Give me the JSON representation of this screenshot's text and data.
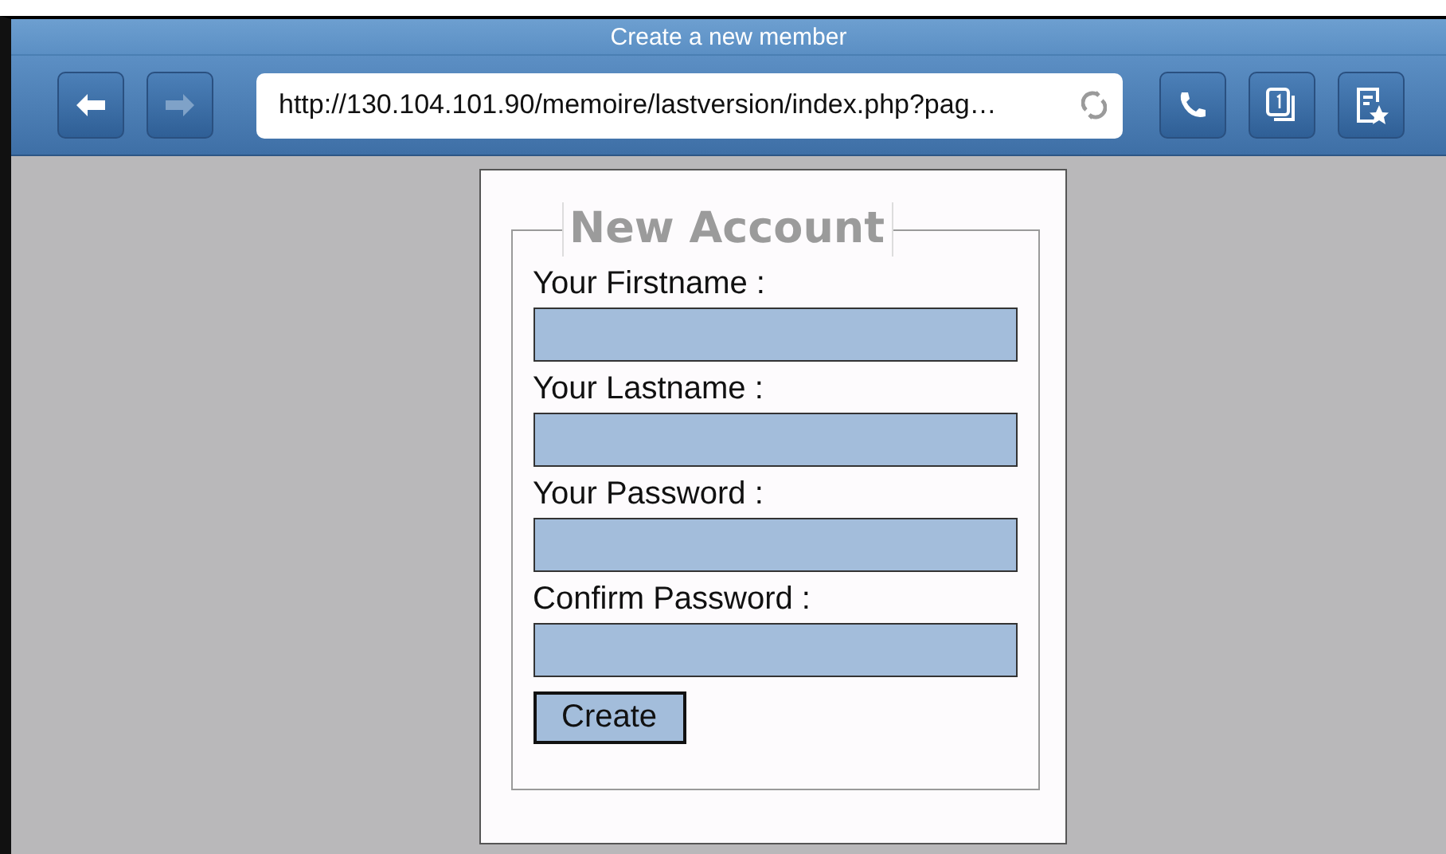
{
  "window": {
    "title": "Create a new member"
  },
  "toolbar": {
    "back": {
      "disabled": false
    },
    "forward": {
      "disabled": true
    },
    "address": "http://130.104.101.90/memoire/lastversion/index.php?pag…"
  },
  "form": {
    "legend": "New Account",
    "fields": [
      {
        "label": "Your Firstname :"
      },
      {
        "label": "Your Lastname :"
      },
      {
        "label": "Your Password :"
      },
      {
        "label": "Confirm Password :"
      }
    ],
    "button": "Create"
  }
}
